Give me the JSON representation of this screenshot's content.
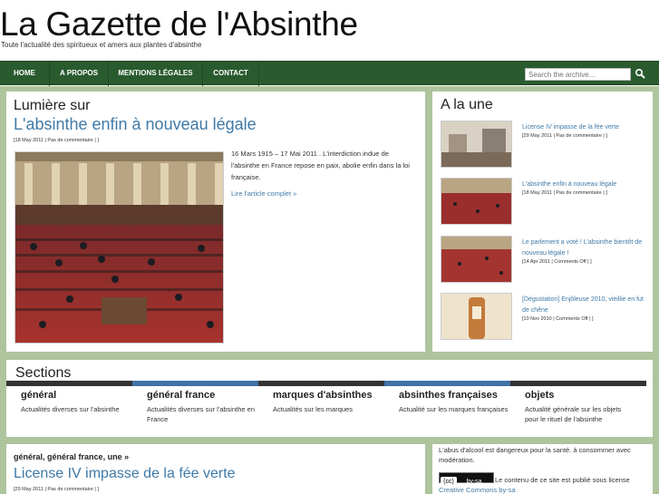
{
  "site": {
    "title": "La Gazette de l'Absinthe",
    "tagline": "Toute l'actualité des spiritueux et amers aux plantes d'absinthe"
  },
  "nav": {
    "items": [
      "HOME",
      "A PROPOS",
      "MENTIONS LÉGALES",
      "CONTACT"
    ],
    "search_placeholder": "Search the archive..."
  },
  "featured": {
    "heading": "Lumière sur",
    "title": "L'absinthe enfin à nouveau légale",
    "meta_date": "[18 May 2011 | ",
    "meta_comments": "Pas de commentaire",
    "meta_end": " | ]",
    "excerpt": "16 Mars 1915 – 17 Mai 2011 . L'interdiction indue de l'absinthe en France repose en paix, abolie enfin dans la loi française.",
    "read_more": "Lire l'article complet »"
  },
  "une": {
    "heading": "A la une",
    "items": [
      {
        "title": "License IV impasse de la fée verte",
        "meta": "[29 May 2011 | Pas de commentaire | ]"
      },
      {
        "title": "L'absinthe enfin à nouveau légale",
        "meta": "[18 May 2011 | Pas de commentaire | ]"
      },
      {
        "title": "Le parlement a voté ! L'absinthe bientôt de nouveau légale !",
        "meta": "[14 Apr 2011 | Comments Off | ]"
      },
      {
        "title": "[Dégustation] Enjôleuse 2010, vieillie en fut de chêne",
        "meta": "[10 Nov 2010 | Comments Off | ]"
      }
    ]
  },
  "sections": {
    "heading": "Sections",
    "items": [
      {
        "name": "général",
        "desc": "Actualités diverses sur l'absinthe",
        "color": "#333333"
      },
      {
        "name": "général france",
        "desc": "Actualités diverses sur l'absinthe en France",
        "color": "#3f72a6"
      },
      {
        "name": "marques d'absinthes",
        "desc": "Actualités sur les marques",
        "color": "#333333"
      },
      {
        "name": "absinthes françaises",
        "desc": "Actualité sur les marques françaises",
        "color": "#3f72a6"
      },
      {
        "name": "objets",
        "desc": "Actualité générale sur les objets pour le rituel de l'absinthe",
        "color": "#333333"
      }
    ]
  },
  "post": {
    "cats": [
      "général",
      "général france",
      "une"
    ],
    "cats_sep": ", ",
    "cats_end": " »",
    "title": "License IV impasse de la fée verte",
    "meta": "[29 May 2011 | Pas de commentaire | ]"
  },
  "sidebar": {
    "warning": "L'abus d'alcool est dangereux pour la santé. à consommer avec modération.",
    "cc_badge": "by-sa",
    "cc_text": "Le contenu de ce site est publié sous license",
    "cc_link": "Creative Commons by-sa"
  },
  "colors": {
    "nav_bg": "#295b2f",
    "band_bg": "#aec49d",
    "link": "#3f7aa8"
  }
}
